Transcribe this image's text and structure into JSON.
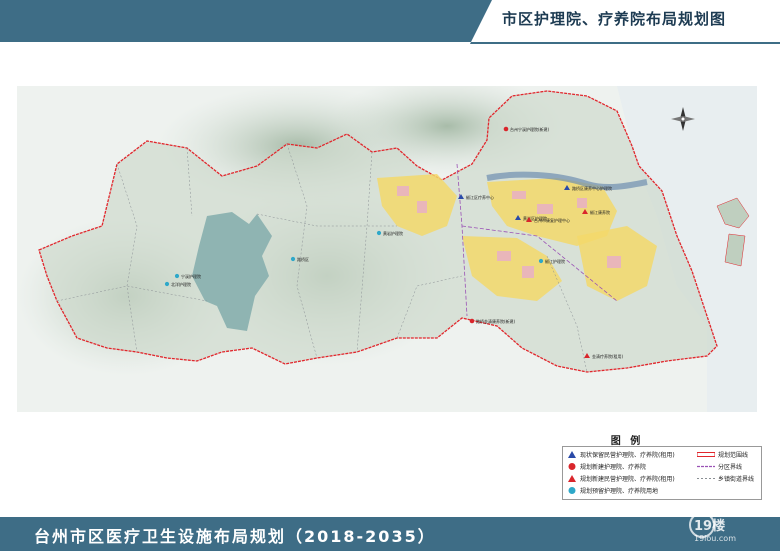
{
  "header": {
    "title": "市区护理院、疗养院布局规划图"
  },
  "footer": {
    "title": "台州市区医疗卫生设施布局规划（2018-2035）"
  },
  "legend": {
    "title": "图 例",
    "items": [
      {
        "label": "现状保留民营护理院、疗养院(租用)",
        "symbol": "blue-triangle"
      },
      {
        "label": "规划新建护理院、疗养院",
        "symbol": "red-circle"
      },
      {
        "label": "规划新建民营护理院、疗养院(租用)",
        "symbol": "red-triangle"
      },
      {
        "label": "规划预留护理院、疗养院用地",
        "symbol": "cyan-circle"
      },
      {
        "label": "规划范围线",
        "symbol": "red-boundary-line"
      },
      {
        "label": "分区界线",
        "symbol": "purple-boundary-line"
      },
      {
        "label": "乡镇街道界线",
        "symbol": "gray-boundary-line"
      }
    ]
  },
  "map": {
    "facilities": [
      {
        "name": "台州宁溪护理院(新建)",
        "symbol": "red-circle"
      },
      {
        "name": "路桥区康养中心护理院",
        "symbol": "blue-triangle"
      },
      {
        "name": "椒江区疗养中心",
        "symbol": "blue-triangle"
      },
      {
        "name": "黄岩区护理院",
        "symbol": "blue-triangle"
      },
      {
        "name": "台州市康复护理中心",
        "symbol": "red-triangle"
      },
      {
        "name": "椒江康养院",
        "symbol": "red-triangle"
      },
      {
        "name": "黄岩护理院",
        "symbol": "cyan-circle"
      },
      {
        "name": "宁溪护理院",
        "symbol": "cyan-circle"
      },
      {
        "name": "北洋护理院",
        "symbol": "cyan-circle"
      },
      {
        "name": "路桥区",
        "symbol": "cyan-circle"
      },
      {
        "name": "椒江护理院",
        "symbol": "cyan-circle"
      },
      {
        "name": "路桥金清康养院(新建)",
        "symbol": "red-circle"
      },
      {
        "name": "金清疗养院(租用)",
        "symbol": "red-triangle"
      }
    ]
  },
  "colors": {
    "bar": "#3e6d86",
    "boundary": "#e1262c",
    "district_line": "#9a52b5",
    "terrain": "#c9d7ca",
    "lake": "#8fb4b2",
    "urban": "#f3d86b"
  },
  "watermark": {
    "brand": "19楼",
    "site": "19lou.com"
  }
}
